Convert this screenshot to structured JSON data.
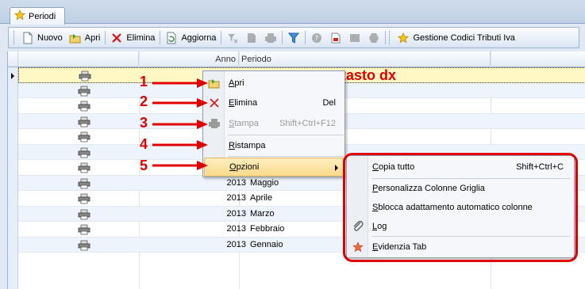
{
  "tabstrip": {
    "tab_label": "Periodi"
  },
  "toolbar": {
    "nuovo": "Nuovo",
    "apri": "Apri",
    "elimina": "Elimina",
    "aggiorna": "Aggiorna",
    "gestione": "Gestione Codici Tributi Iva"
  },
  "grid": {
    "columns": [
      "Anno",
      "Periodo"
    ],
    "rows": [
      {
        "anno": "",
        "periodo": ""
      },
      {
        "anno": "",
        "periodo": ""
      },
      {
        "anno": "",
        "periodo": ""
      },
      {
        "anno": "",
        "periodo": ""
      },
      {
        "anno": "",
        "periodo": ""
      },
      {
        "anno": "",
        "periodo": ""
      },
      {
        "anno": "",
        "periodo": ""
      },
      {
        "anno": "2013",
        "periodo": "Maggio"
      },
      {
        "anno": "2013",
        "periodo": "Aprile"
      },
      {
        "anno": "2013",
        "periodo": "Marzo"
      },
      {
        "anno": "2013",
        "periodo": "Febbraio"
      },
      {
        "anno": "2013",
        "periodo": "Gennaio"
      }
    ]
  },
  "annotation": {
    "text": "tasto dx",
    "numbers": [
      "1",
      "2",
      "3",
      "4",
      "5"
    ],
    "color": "#e00000"
  },
  "context_menu": {
    "apri": "Apri",
    "elimina": "Elimina",
    "elimina_key": "Del",
    "stampa": "Stampa",
    "stampa_key": "Shift+Ctrl+F12",
    "ristampa": "Ristampa",
    "opzioni": "Opzioni"
  },
  "submenu": {
    "copia": "Copia tutto",
    "copia_key": "Shift+Ctrl+C",
    "personalizza": "Personalizza Colonne Griglia",
    "sblocca": "Sblocca adattamento automatico colonne",
    "log": "Log",
    "evidenzia": "Evidenzia Tab"
  }
}
